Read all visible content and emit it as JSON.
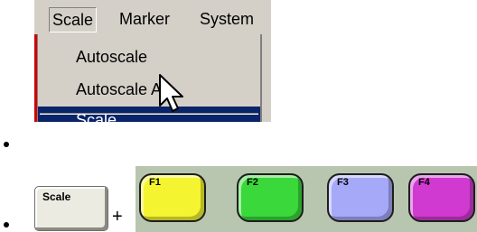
{
  "menubar": {
    "items": [
      {
        "label": "Scale"
      },
      {
        "label": "Marker"
      },
      {
        "label": "System"
      }
    ]
  },
  "dropdown": {
    "items": [
      {
        "label": "Autoscale"
      },
      {
        "label": "Autoscale All"
      },
      {
        "label": "Scale..."
      }
    ],
    "selected": "Scale...",
    "highlight_color": "#0a246a"
  },
  "keys": {
    "hard_key_label": "Scale",
    "plus": "+",
    "function_keys": [
      {
        "label": "F1",
        "color": "#f4f431"
      },
      {
        "label": "F2",
        "color": "#3ad83a"
      },
      {
        "label": "F3",
        "color": "#a6a8f8"
      },
      {
        "label": "F4",
        "color": "#d03ad0"
      }
    ]
  },
  "colors": {
    "menu_background": "#d4d0c8",
    "fkey_panel": "#b8c6b0"
  },
  "icons": {
    "cursor": "arrow-pointer-icon"
  }
}
